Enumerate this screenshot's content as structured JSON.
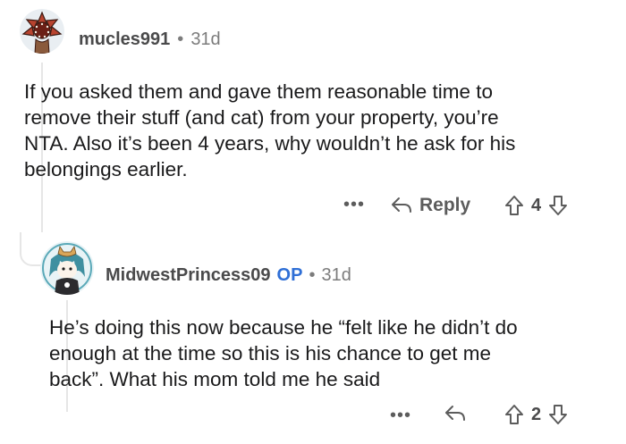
{
  "comment1": {
    "avatar_icon": "demogorgon-avatar-icon",
    "username": "mucles991",
    "separator": "•",
    "age": "31d",
    "body_lines": [
      "If you asked them and gave them reasonable time to",
      "remove their stuff (and cat) from your property, you’re",
      "NTA. Also it’s been 4 years, why wouldn’t he ask for his",
      "belongings earlier."
    ],
    "more": "•••",
    "reply_label": "Reply",
    "votes": "4"
  },
  "comment2": {
    "avatar_icon": "cat-avatar-icon",
    "username": "MidwestPrincess09",
    "op_badge": "OP",
    "separator": "•",
    "age": "31d",
    "body_lines": [
      "He’s doing this now because he “felt like he didn’t do",
      "enough at the time so this is his chance to get me",
      "back”. What his mom told me he said"
    ],
    "more": "•••",
    "votes": "2"
  },
  "colors": {
    "op": "#2f6fd6",
    "text": "#1a1a1b",
    "meta": "#7c7c7c"
  }
}
